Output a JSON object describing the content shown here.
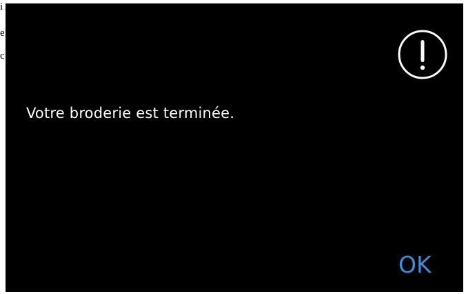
{
  "left_fragments": [
    "i",
    "e",
    "c"
  ],
  "dialog": {
    "icon": "exclamation-circle-icon",
    "message": "Votre broderie est terminée.",
    "ok_label": "OK"
  },
  "colors": {
    "dialog_background": "#000000",
    "message_text": "#ffffff",
    "ok_text": "#3a8fe0",
    "icon_stroke": "#ffffff"
  }
}
